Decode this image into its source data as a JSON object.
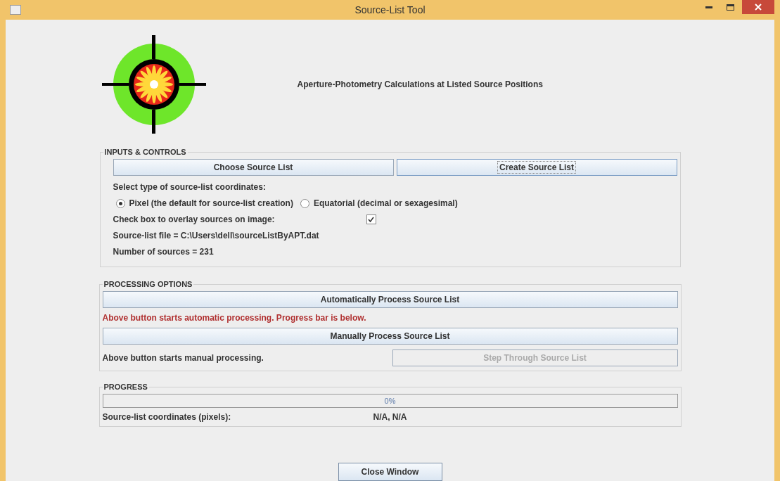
{
  "window": {
    "title": "Source-List Tool"
  },
  "header": {
    "subtitle": "Aperture-Photometry Calculations at Listed Source Positions"
  },
  "inputs": {
    "title": "INPUTS & CONTROLS",
    "buttons": [
      {
        "label": "Choose Source List",
        "focused": false
      },
      {
        "label": "Create Source List",
        "focused": true
      }
    ],
    "coord_prompt": "Select type of source-list coordinates:",
    "coord_options": [
      {
        "label": "Pixel (the default for source-list creation)",
        "selected": true
      },
      {
        "label": "Equatorial (decimal or sexagesimal)",
        "selected": false
      }
    ],
    "overlay": {
      "label": "Check box to overlay sources on image:",
      "checked": true
    },
    "file_line": "Source-list file = C:\\Users\\dell\\sourceListByAPT.dat",
    "count_line": "Number of sources = 231"
  },
  "processing": {
    "title": "PROCESSING OPTIONS",
    "auto_button": {
      "label": "Automatically Process Source List"
    },
    "auto_note": "Above button starts automatic processing. Progress bar is below.",
    "manual_button": {
      "label": "Manually Process Source List"
    },
    "manual_note": "Above button starts manual processing.",
    "step_button": {
      "label": "Step Through Source List",
      "disabled": true
    }
  },
  "progress": {
    "title": "PROGRESS",
    "reading": "0%",
    "coords_label": "Source-list coordinates (pixels):",
    "coords_value": "N/A, N/A"
  },
  "close_button": {
    "label": "Close Window"
  }
}
